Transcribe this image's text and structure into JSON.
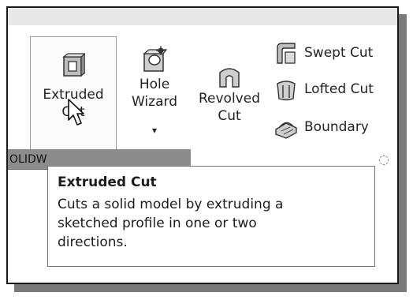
{
  "ribbon": {
    "extruded_cut": {
      "label": "Extruded Cut",
      "icon": "extruded-cut-icon"
    },
    "hole_wizard": {
      "label": "Hole Wizard",
      "caret": "▾",
      "icon": "hole-wizard-icon"
    },
    "revolved_cut": {
      "label": "Revolved Cut",
      "icon": "revolved-cut-icon"
    },
    "small_tools": [
      {
        "label": "Swept Cut",
        "icon": "swept-cut-icon"
      },
      {
        "label": "Lofted Cut",
        "icon": "lofted-cut-icon"
      },
      {
        "label": "Boundary",
        "icon": "boundary-cut-icon"
      }
    ]
  },
  "tabstrip": {
    "label": "OLIDW"
  },
  "tooltip": {
    "title": "Extruded Cut",
    "body": "Cuts a solid model by extruding a sketched profile in one or two directions."
  },
  "colors": {
    "frame": "#1a1a1a",
    "tab_strip": "#8c8c8c",
    "button_border": "#9a9a9a"
  }
}
